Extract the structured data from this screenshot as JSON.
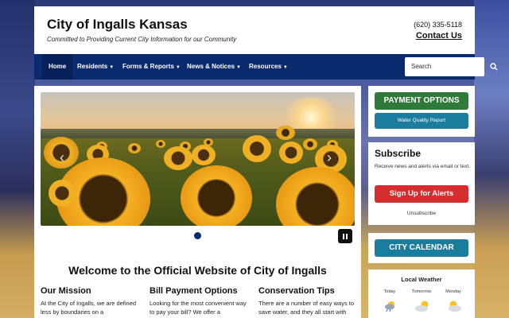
{
  "header": {
    "title": "City of Ingalls Kansas",
    "tagline": "Committed to Providing Current City Information for our Community",
    "phone": "(620) 335-5118",
    "contact_label": "Contact Us"
  },
  "nav": {
    "items": [
      {
        "label": "Home",
        "active": true
      },
      {
        "label": "Residents"
      },
      {
        "label": "Forms & Reports"
      },
      {
        "label": "News & Notices"
      },
      {
        "label": "Resources"
      }
    ],
    "search_placeholder": "Search",
    "search_icon": "search-icon"
  },
  "main": {
    "slideshow": {
      "current_slide": 1,
      "total_slides": 1
    },
    "welcome": "Welcome to the Official Website of City of Ingalls",
    "columns": [
      {
        "title": "Our Mission",
        "text": "At the City of Ingalls, we are defined less by boundaries on a"
      },
      {
        "title": "Bill Payment Options",
        "text": "Looking for the most convenient way to pay your bill? We offer a"
      },
      {
        "title": "Conservation Tips",
        "text": "There are a number of easy ways to save water, and they all start with"
      }
    ]
  },
  "sidebar": {
    "payment_label": "PAYMENT OPTIONS",
    "water_report_label": "Water Quality Report",
    "subscribe_title": "Subscribe",
    "subscribe_text": "Receive news and alerts via email or text.",
    "signup_label": "Sign Up for Alerts",
    "unsubscribe_label": "Unsubscribe",
    "calendar_label": "CITY CALENDAR",
    "weather_title": "Local Weather",
    "weather_days": [
      {
        "day": "Today",
        "icon": "partly-cloudy-rain-icon"
      },
      {
        "day": "Tomorrow",
        "icon": "partly-cloudy-icon"
      },
      {
        "day": "Monday",
        "icon": "partly-cloudy-icon"
      }
    ]
  },
  "colors": {
    "nav_bg": "#0a2a6e",
    "payment_green": "#2f7a3a",
    "teal": "#1a7d9e",
    "alert_red": "#d62e2e"
  }
}
